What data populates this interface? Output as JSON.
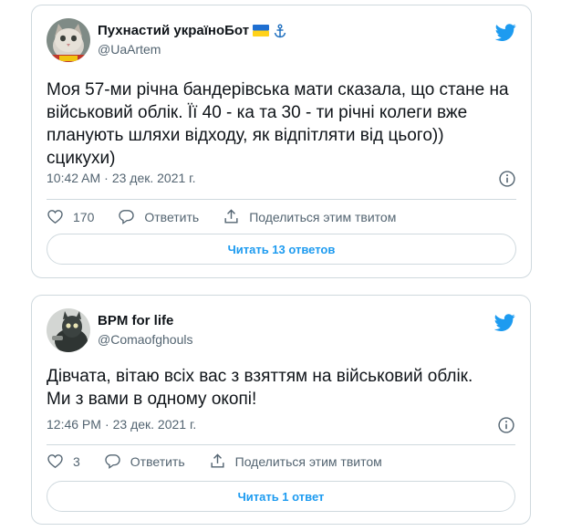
{
  "colors": {
    "accent": "#1d9bf0",
    "text": "#0f1419",
    "muted": "#536471",
    "border": "#cfd9de"
  },
  "tweets": [
    {
      "display_name": "Пухнастий україноБот",
      "name_badges": [
        "ukraine-flag-icon",
        "anchor-icon"
      ],
      "handle": "@UaArtem",
      "text": "Моя 57-ми річна бандерівська мати сказала, що стане на військовий облік. Її 40 - ка та 30 - ти річні колеги вже планують шляхи відходу, як відпітляти від цього))\nсцикухи)",
      "time": "10:42 AM",
      "date": "23 дек. 2021 г.",
      "likes": "170",
      "reply_label": "Ответить",
      "share_label": "Поделиться этим твитом",
      "read_replies_label": "Читать 13 ответов"
    },
    {
      "display_name": "BPM for life",
      "name_badges": [],
      "handle": "@Comaofghouls",
      "text": "Дівчата, вітаю всіх вас з взяттям на військовий облік.\nМи з вами в одному окопі!",
      "time": "12:46 PM",
      "date": "23 дек. 2021 г.",
      "likes": "3",
      "reply_label": "Ответить",
      "share_label": "Поделиться этим твитом",
      "read_replies_label": "Читать 1 ответ"
    }
  ]
}
